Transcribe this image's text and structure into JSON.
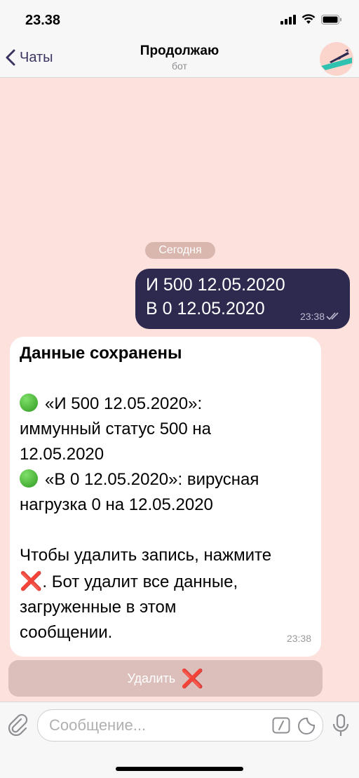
{
  "status_bar": {
    "time": "23.38"
  },
  "nav": {
    "back_label": "Чаты",
    "title": "Продолжаю",
    "subtitle": "бот"
  },
  "chat": {
    "date_separator": "Сегодня",
    "outgoing": {
      "line1": "И 500 12.05.2020",
      "line2": "В 0 12.05.2020",
      "time": "23:38",
      "status": "read"
    },
    "incoming": {
      "heading": "Данные сохранены",
      "item1_line1": "«И 500 12.05.2020»:",
      "item1_line2": "иммунный статус 500 на",
      "item1_line3": "12.05.2020",
      "item2_line1": "«В 0 12.05.2020»: вирусная",
      "item2_line2": "нагрузка 0 на 12.05.2020",
      "note_line1": "Чтобы удалить запись, нажмите",
      "note_line2": ". Бот удалит все данные,",
      "note_line3": "загруженные в этом",
      "note_line4": "сообщении.",
      "red_x": "❌",
      "time": "23:38"
    },
    "inline_button": {
      "label": "Удалить",
      "icon": "❌"
    }
  },
  "composer": {
    "placeholder": "Сообщение..."
  },
  "colors": {
    "chat_background": "#fce1dc",
    "outgoing_bubble": "#2e2a4f",
    "accent": "#3a3560",
    "inline_button": "#dcbfbb"
  }
}
